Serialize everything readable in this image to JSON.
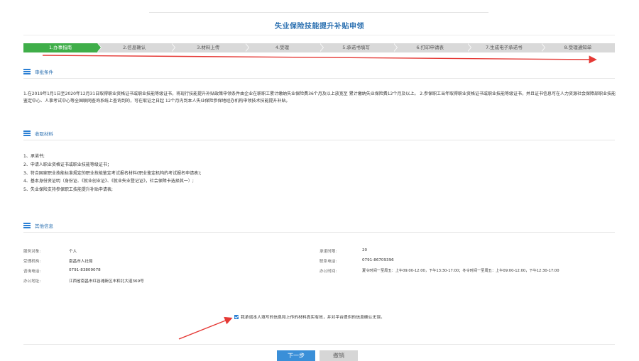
{
  "page": {
    "title": "失业保险技能提升补贴申领"
  },
  "steps": [
    {
      "label": "1.办事指南",
      "active": true
    },
    {
      "label": "2.信息确认",
      "active": false
    },
    {
      "label": "3.材料上传",
      "active": false
    },
    {
      "label": "4.受理",
      "active": false
    },
    {
      "label": "5.承诺书填写",
      "active": false
    },
    {
      "label": "6.打印申请表",
      "active": false
    },
    {
      "label": "7.生成电子承诺书",
      "active": false
    },
    {
      "label": "8.受理通知单",
      "active": false
    }
  ],
  "sections": {
    "conditions": {
      "title": "审批条件",
      "text": "1.在2019年1月1日至2020年12月31日取得职业资格证书或职业技能等级证书，将现行技能提升补贴政策申领条件由企业在职职工累计缴纳失业保险费36个月及以上放宽至 累计缴纳失业保险费12个月及以上。 2.参保职工当年取得职业资格证书或职业技能等级证书，并且证书信息可在人力资源社会保障部职业技能鉴定中心、人事考试中心等全国联网查询系统上查询到的，可在取证之日起 12个月内到本人失业保险参保地经办机构申领技术技能提升补贴。"
    },
    "materials": {
      "title": "收取材料",
      "items": [
        "1、承诺书;",
        "2、申请人职业资格证书或职业技能等级证书；",
        "3、符合国家职业技能标准规定的职业技能鉴定考试报名材料(职业鉴定机构的考试报名申请表);",
        "4、基本身份资证明（身份证、《就业创业证》、《就业失业登记证》，社会保障卡选择其一）;",
        "5、失业保险支持参保职工技能提升补贴申请表;"
      ]
    },
    "other": {
      "title": "其他信息",
      "left": [
        {
          "label": "服务对象:",
          "value": "个人"
        },
        {
          "label": "受理机构:",
          "value": "南昌市人社局"
        },
        {
          "label": "咨询电话:",
          "value": "0791-83809078"
        },
        {
          "label": "办公地址:",
          "value": "江西省南昌市红谷滩新区丰和北大道369号"
        }
      ],
      "right": [
        {
          "label": "承诺时限:",
          "value": "20"
        },
        {
          "label": "联系电话:",
          "value": "0791-86709396"
        },
        {
          "label": "办公时间:",
          "value": "夏令时间一至周五：上午09:00-12:00，下午13:30-17:00；冬令时间一至周五：上午09:00-12:00，下午12:30-17:00"
        }
      ]
    }
  },
  "agreement": {
    "text": "我承诺本人填写的信息和上传的材料真实有效，并对平台提供的信息确认无误。",
    "checked": true
  },
  "buttons": {
    "next": "下一步",
    "cancel": "撤销"
  },
  "colors": {
    "accent": "#2a7fd4",
    "step_active": "#3fae49",
    "step_inactive": "#d9d9d9",
    "annotation": "#e53935"
  },
  "icons": {
    "section": "list-icon",
    "checkbox": "checkbox-checked"
  }
}
